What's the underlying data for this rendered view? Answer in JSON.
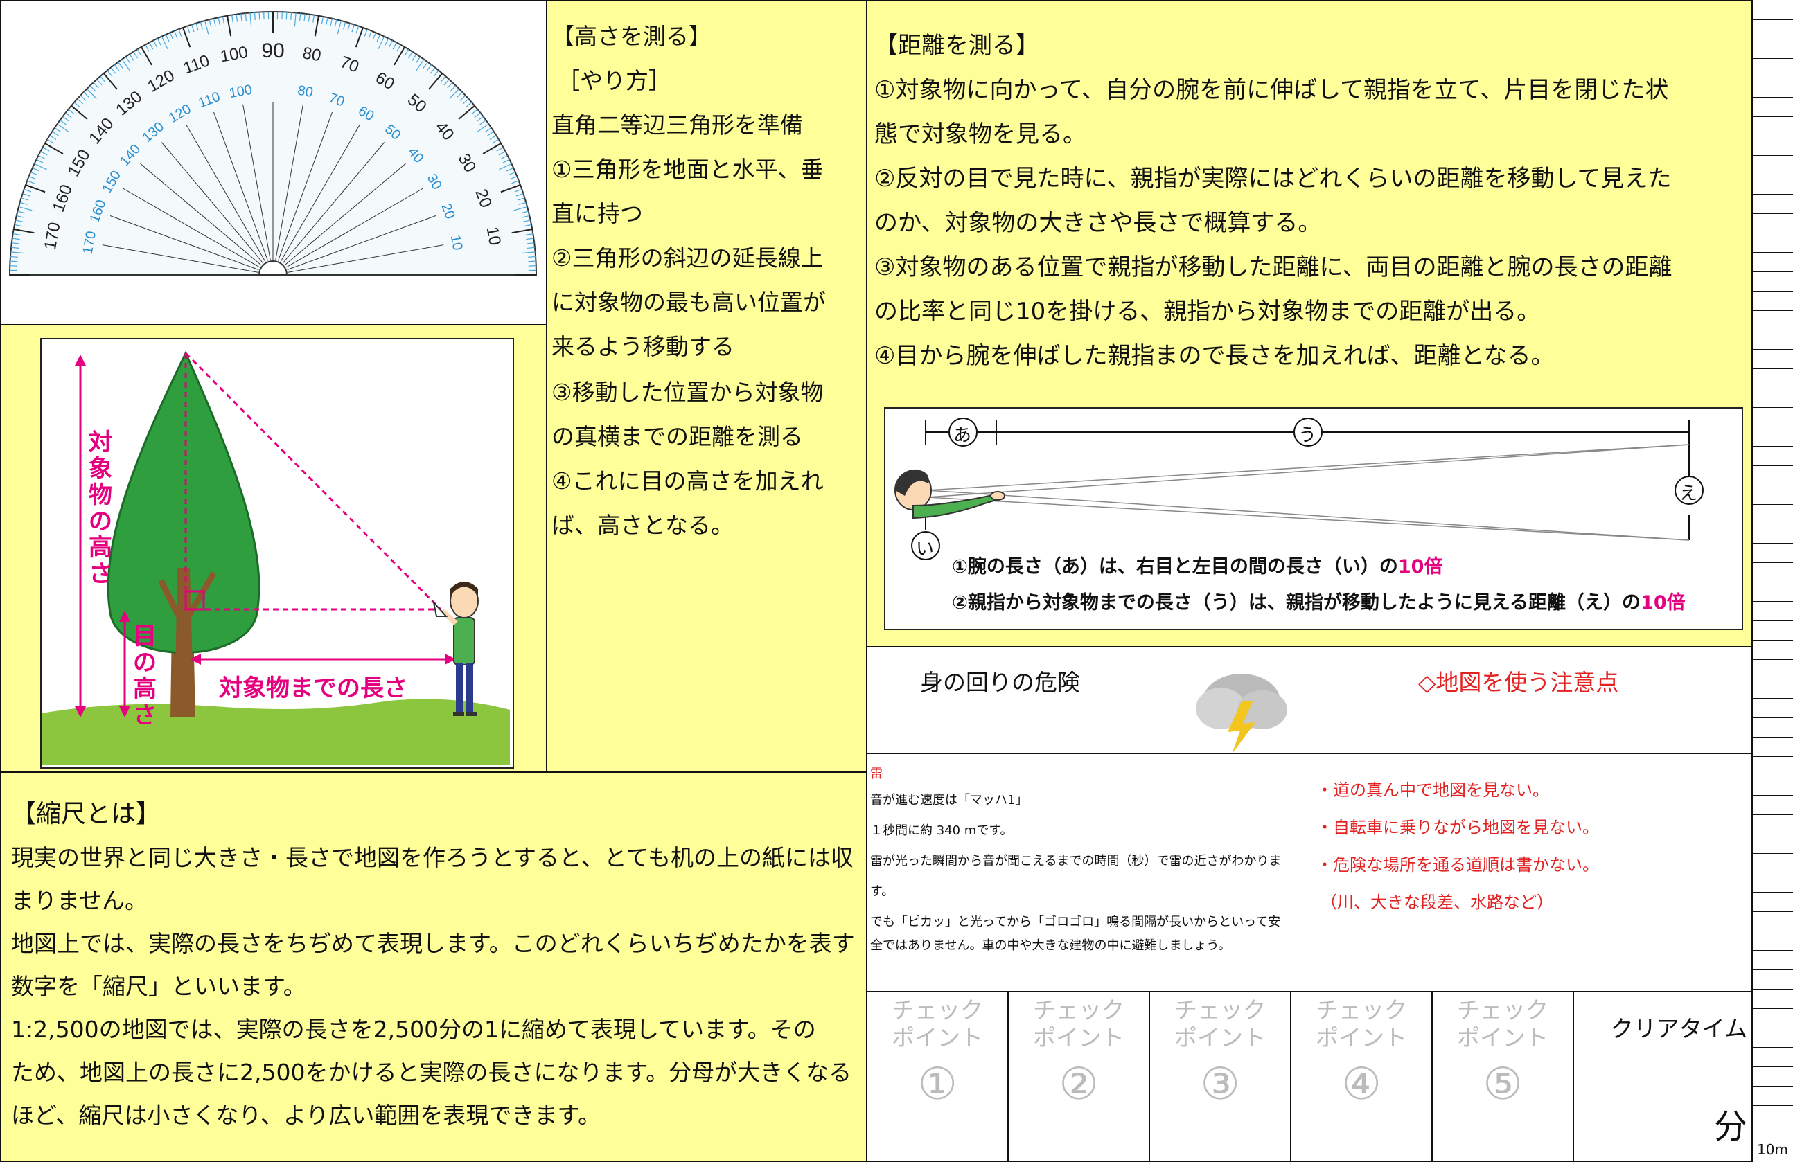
{
  "protractor": {
    "outer_labels": [
      "170",
      "160",
      "150",
      "140",
      "130",
      "120",
      "110",
      "100",
      "90",
      "80",
      "70",
      "60",
      "50",
      "40",
      "30",
      "20",
      "10"
    ],
    "inner_labels": [
      "10",
      "20",
      "30",
      "40",
      "50",
      "60",
      "70",
      "80",
      "100",
      "110",
      "120",
      "130",
      "140",
      "150",
      "160",
      "170"
    ]
  },
  "height_section": {
    "title": "【高さを測る】",
    "subtitle": "［やり方］",
    "lines": [
      "直角二等辺三角形を準備",
      "①三角形を地面と水平、垂",
      "直に持つ",
      "②三角形の斜辺の延長線上",
      "に対象物の最も高い位置が",
      "来るよう移動する",
      "③移動した位置から対象物",
      "の真横までの距離を測る",
      "④これに目の高さを加えれ",
      "ば、高さとなる。"
    ],
    "diagram": {
      "label_object_height": "対象物の高さ",
      "label_eye_height": "目の高さ",
      "label_distance": "対象物までの長さ"
    }
  },
  "distance_section": {
    "title": "【距離を測る】",
    "lines": [
      "①対象物に向かって、自分の腕を前に伸ばして親指を立て、片目を閉じた状",
      "態で対象物を見る。",
      "②反対の目で見た時に、親指が実際にはどれくらいの距離を移動して見えた",
      "のか、対象物の大きさや長さで概算する。",
      "③対象物のある位置で親指が移動した距離に、両目の距離と腕の長さの距離",
      "の比率と同じ10を掛ける、親指から対象物までの距離が出る。",
      "④目から腕を伸ばした親指まので長さを加えれば、距離となる。"
    ],
    "diagram": {
      "marker_a": "あ",
      "marker_u": "う",
      "marker_e": "え",
      "marker_i": "い",
      "note1_text": "①腕の長さ（あ）は、右目と左目の間の長さ（い）の",
      "note1_highlight": "10倍",
      "note2_text": "②親指から対象物までの長さ（う）は、親指が移動したように見える距離（え）の",
      "note2_highlight": "10倍"
    }
  },
  "danger_section": {
    "title": "身の回りの危険",
    "thunder": {
      "heading": "雷",
      "lines": [
        "音が進む速度は「マッハ1」",
        "１秒間に約 340 mです。",
        "雷が光った瞬間から音が聞こえるまでの時間（秒）で雷の近さがわかりま",
        "す。",
        "でも「ピカッ」と光ってから「ゴロゴロ」鳴る間隔が長いからといって安",
        "全ではありません。車の中や大きな建物の中に避難しましょう。"
      ]
    }
  },
  "map_section": {
    "title": "◇地図を使う注意点",
    "items": [
      "・道の真ん中で地図を見ない。",
      "・自転車に乗りながら地図を見ない。",
      "・危険な場所を通る道順は書かない。",
      "（川、大きな段差、水路など）"
    ]
  },
  "scale_section": {
    "title": "【縮尺とは】",
    "lines": [
      "現実の世界と同じ大きさ・長さで地図を作ろうとすると、とても机の上の紙には収",
      "まりません。",
      "地図上では、実際の長さをちぢめて表現します。このどれくらいちぢめたかを表す",
      "数字を「縮尺」といいます。",
      "1:2,500の地図では、実際の長さを2,500分の1に縮めて表現しています。その",
      "ため、地図上の長さに2,500をかけると実際の長さになります。分母が大きくなる",
      "ほど、縮尺は小さくなり、より広い範囲を表現できます。"
    ]
  },
  "checkpoints": {
    "label_top": "チェック",
    "label_bottom": "ポイント",
    "numbers": [
      "①",
      "②",
      "③",
      "④",
      "⑤"
    ],
    "clear_time": "クリアタイム",
    "minutes": "分"
  },
  "ruler_label": "10m",
  "colors": {
    "panel": "#ffff99",
    "accent_red": "#e32222",
    "accent_magenta": "#e4007f",
    "tree": "#2e9e3e"
  }
}
